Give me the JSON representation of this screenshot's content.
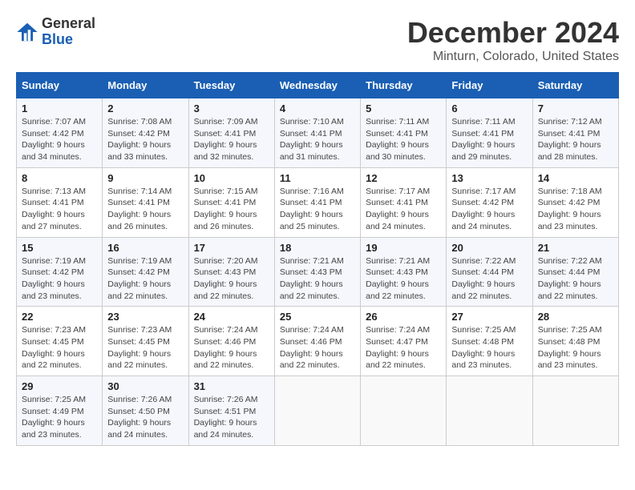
{
  "logo": {
    "line1": "General",
    "line2": "Blue"
  },
  "title": "December 2024",
  "subtitle": "Minturn, Colorado, United States",
  "header": {
    "cols": [
      "Sunday",
      "Monday",
      "Tuesday",
      "Wednesday",
      "Thursday",
      "Friday",
      "Saturday"
    ]
  },
  "weeks": [
    [
      {
        "day": "1",
        "sunrise": "7:07 AM",
        "sunset": "4:42 PM",
        "daylight": "9 hours and 34 minutes."
      },
      {
        "day": "2",
        "sunrise": "7:08 AM",
        "sunset": "4:42 PM",
        "daylight": "9 hours and 33 minutes."
      },
      {
        "day": "3",
        "sunrise": "7:09 AM",
        "sunset": "4:41 PM",
        "daylight": "9 hours and 32 minutes."
      },
      {
        "day": "4",
        "sunrise": "7:10 AM",
        "sunset": "4:41 PM",
        "daylight": "9 hours and 31 minutes."
      },
      {
        "day": "5",
        "sunrise": "7:11 AM",
        "sunset": "4:41 PM",
        "daylight": "9 hours and 30 minutes."
      },
      {
        "day": "6",
        "sunrise": "7:11 AM",
        "sunset": "4:41 PM",
        "daylight": "9 hours and 29 minutes."
      },
      {
        "day": "7",
        "sunrise": "7:12 AM",
        "sunset": "4:41 PM",
        "daylight": "9 hours and 28 minutes."
      }
    ],
    [
      {
        "day": "8",
        "sunrise": "7:13 AM",
        "sunset": "4:41 PM",
        "daylight": "9 hours and 27 minutes."
      },
      {
        "day": "9",
        "sunrise": "7:14 AM",
        "sunset": "4:41 PM",
        "daylight": "9 hours and 26 minutes."
      },
      {
        "day": "10",
        "sunrise": "7:15 AM",
        "sunset": "4:41 PM",
        "daylight": "9 hours and 26 minutes."
      },
      {
        "day": "11",
        "sunrise": "7:16 AM",
        "sunset": "4:41 PM",
        "daylight": "9 hours and 25 minutes."
      },
      {
        "day": "12",
        "sunrise": "7:17 AM",
        "sunset": "4:41 PM",
        "daylight": "9 hours and 24 minutes."
      },
      {
        "day": "13",
        "sunrise": "7:17 AM",
        "sunset": "4:42 PM",
        "daylight": "9 hours and 24 minutes."
      },
      {
        "day": "14",
        "sunrise": "7:18 AM",
        "sunset": "4:42 PM",
        "daylight": "9 hours and 23 minutes."
      }
    ],
    [
      {
        "day": "15",
        "sunrise": "7:19 AM",
        "sunset": "4:42 PM",
        "daylight": "9 hours and 23 minutes."
      },
      {
        "day": "16",
        "sunrise": "7:19 AM",
        "sunset": "4:42 PM",
        "daylight": "9 hours and 22 minutes."
      },
      {
        "day": "17",
        "sunrise": "7:20 AM",
        "sunset": "4:43 PM",
        "daylight": "9 hours and 22 minutes."
      },
      {
        "day": "18",
        "sunrise": "7:21 AM",
        "sunset": "4:43 PM",
        "daylight": "9 hours and 22 minutes."
      },
      {
        "day": "19",
        "sunrise": "7:21 AM",
        "sunset": "4:43 PM",
        "daylight": "9 hours and 22 minutes."
      },
      {
        "day": "20",
        "sunrise": "7:22 AM",
        "sunset": "4:44 PM",
        "daylight": "9 hours and 22 minutes."
      },
      {
        "day": "21",
        "sunrise": "7:22 AM",
        "sunset": "4:44 PM",
        "daylight": "9 hours and 22 minutes."
      }
    ],
    [
      {
        "day": "22",
        "sunrise": "7:23 AM",
        "sunset": "4:45 PM",
        "daylight": "9 hours and 22 minutes."
      },
      {
        "day": "23",
        "sunrise": "7:23 AM",
        "sunset": "4:45 PM",
        "daylight": "9 hours and 22 minutes."
      },
      {
        "day": "24",
        "sunrise": "7:24 AM",
        "sunset": "4:46 PM",
        "daylight": "9 hours and 22 minutes."
      },
      {
        "day": "25",
        "sunrise": "7:24 AM",
        "sunset": "4:46 PM",
        "daylight": "9 hours and 22 minutes."
      },
      {
        "day": "26",
        "sunrise": "7:24 AM",
        "sunset": "4:47 PM",
        "daylight": "9 hours and 22 minutes."
      },
      {
        "day": "27",
        "sunrise": "7:25 AM",
        "sunset": "4:48 PM",
        "daylight": "9 hours and 23 minutes."
      },
      {
        "day": "28",
        "sunrise": "7:25 AM",
        "sunset": "4:48 PM",
        "daylight": "9 hours and 23 minutes."
      }
    ],
    [
      {
        "day": "29",
        "sunrise": "7:25 AM",
        "sunset": "4:49 PM",
        "daylight": "9 hours and 23 minutes."
      },
      {
        "day": "30",
        "sunrise": "7:26 AM",
        "sunset": "4:50 PM",
        "daylight": "9 hours and 24 minutes."
      },
      {
        "day": "31",
        "sunrise": "7:26 AM",
        "sunset": "4:51 PM",
        "daylight": "9 hours and 24 minutes."
      },
      null,
      null,
      null,
      null
    ]
  ],
  "labels": {
    "sunrise": "Sunrise:",
    "sunset": "Sunset:",
    "daylight": "Daylight:"
  }
}
